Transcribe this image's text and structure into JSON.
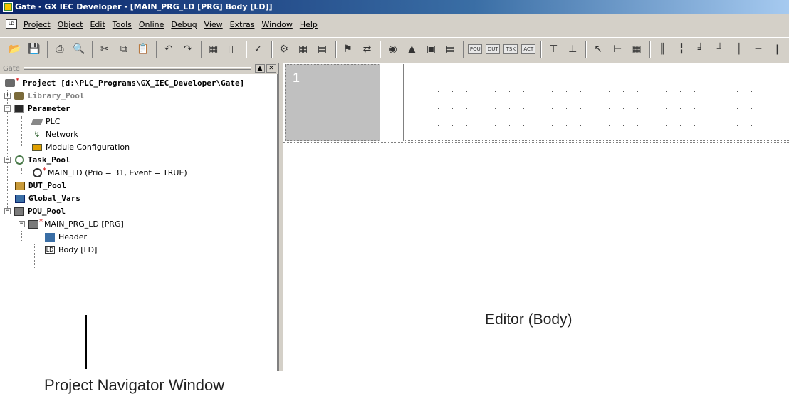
{
  "window": {
    "title": "Gate - GX IEC Developer - [MAIN_PRG_LD [PRG] Body [LD]]"
  },
  "menubar": {
    "badge": "LD",
    "items": [
      "Project",
      "Object",
      "Edit",
      "Tools",
      "Online",
      "Debug",
      "View",
      "Extras",
      "Window",
      "Help"
    ]
  },
  "toolbar": {
    "small_labels": [
      "POU",
      "DUT",
      "TSK",
      "ACT"
    ]
  },
  "navigator": {
    "caption": "Gate",
    "project": "Project [d:\\PLC_Programs\\GX_IEC_Developer\\Gate]",
    "library_pool": "Library_Pool",
    "parameter": "Parameter",
    "plc": "PLC",
    "network": "Network",
    "module_config": "Module Configuration",
    "task_pool": "Task_Pool",
    "task_main": "MAIN_LD (Prio = 31, Event = TRUE)",
    "dut_pool": "DUT_Pool",
    "global_vars": "Global_Vars",
    "pou_pool": "POU_Pool",
    "pou_main": "MAIN_PRG_LD [PRG]",
    "header": "Header",
    "body": "Body [LD]",
    "ld_badge": "LD"
  },
  "editor": {
    "rung_number": "1"
  },
  "annotations": {
    "editor_label": "Editor (Body)",
    "navigator_label": "Project Navigator Window"
  },
  "colors": {
    "titlebar_start": "#0a246a",
    "titlebar_end": "#a6caf0",
    "chrome": "#d4d0c8",
    "rung_cell": "#c0c0c0"
  }
}
